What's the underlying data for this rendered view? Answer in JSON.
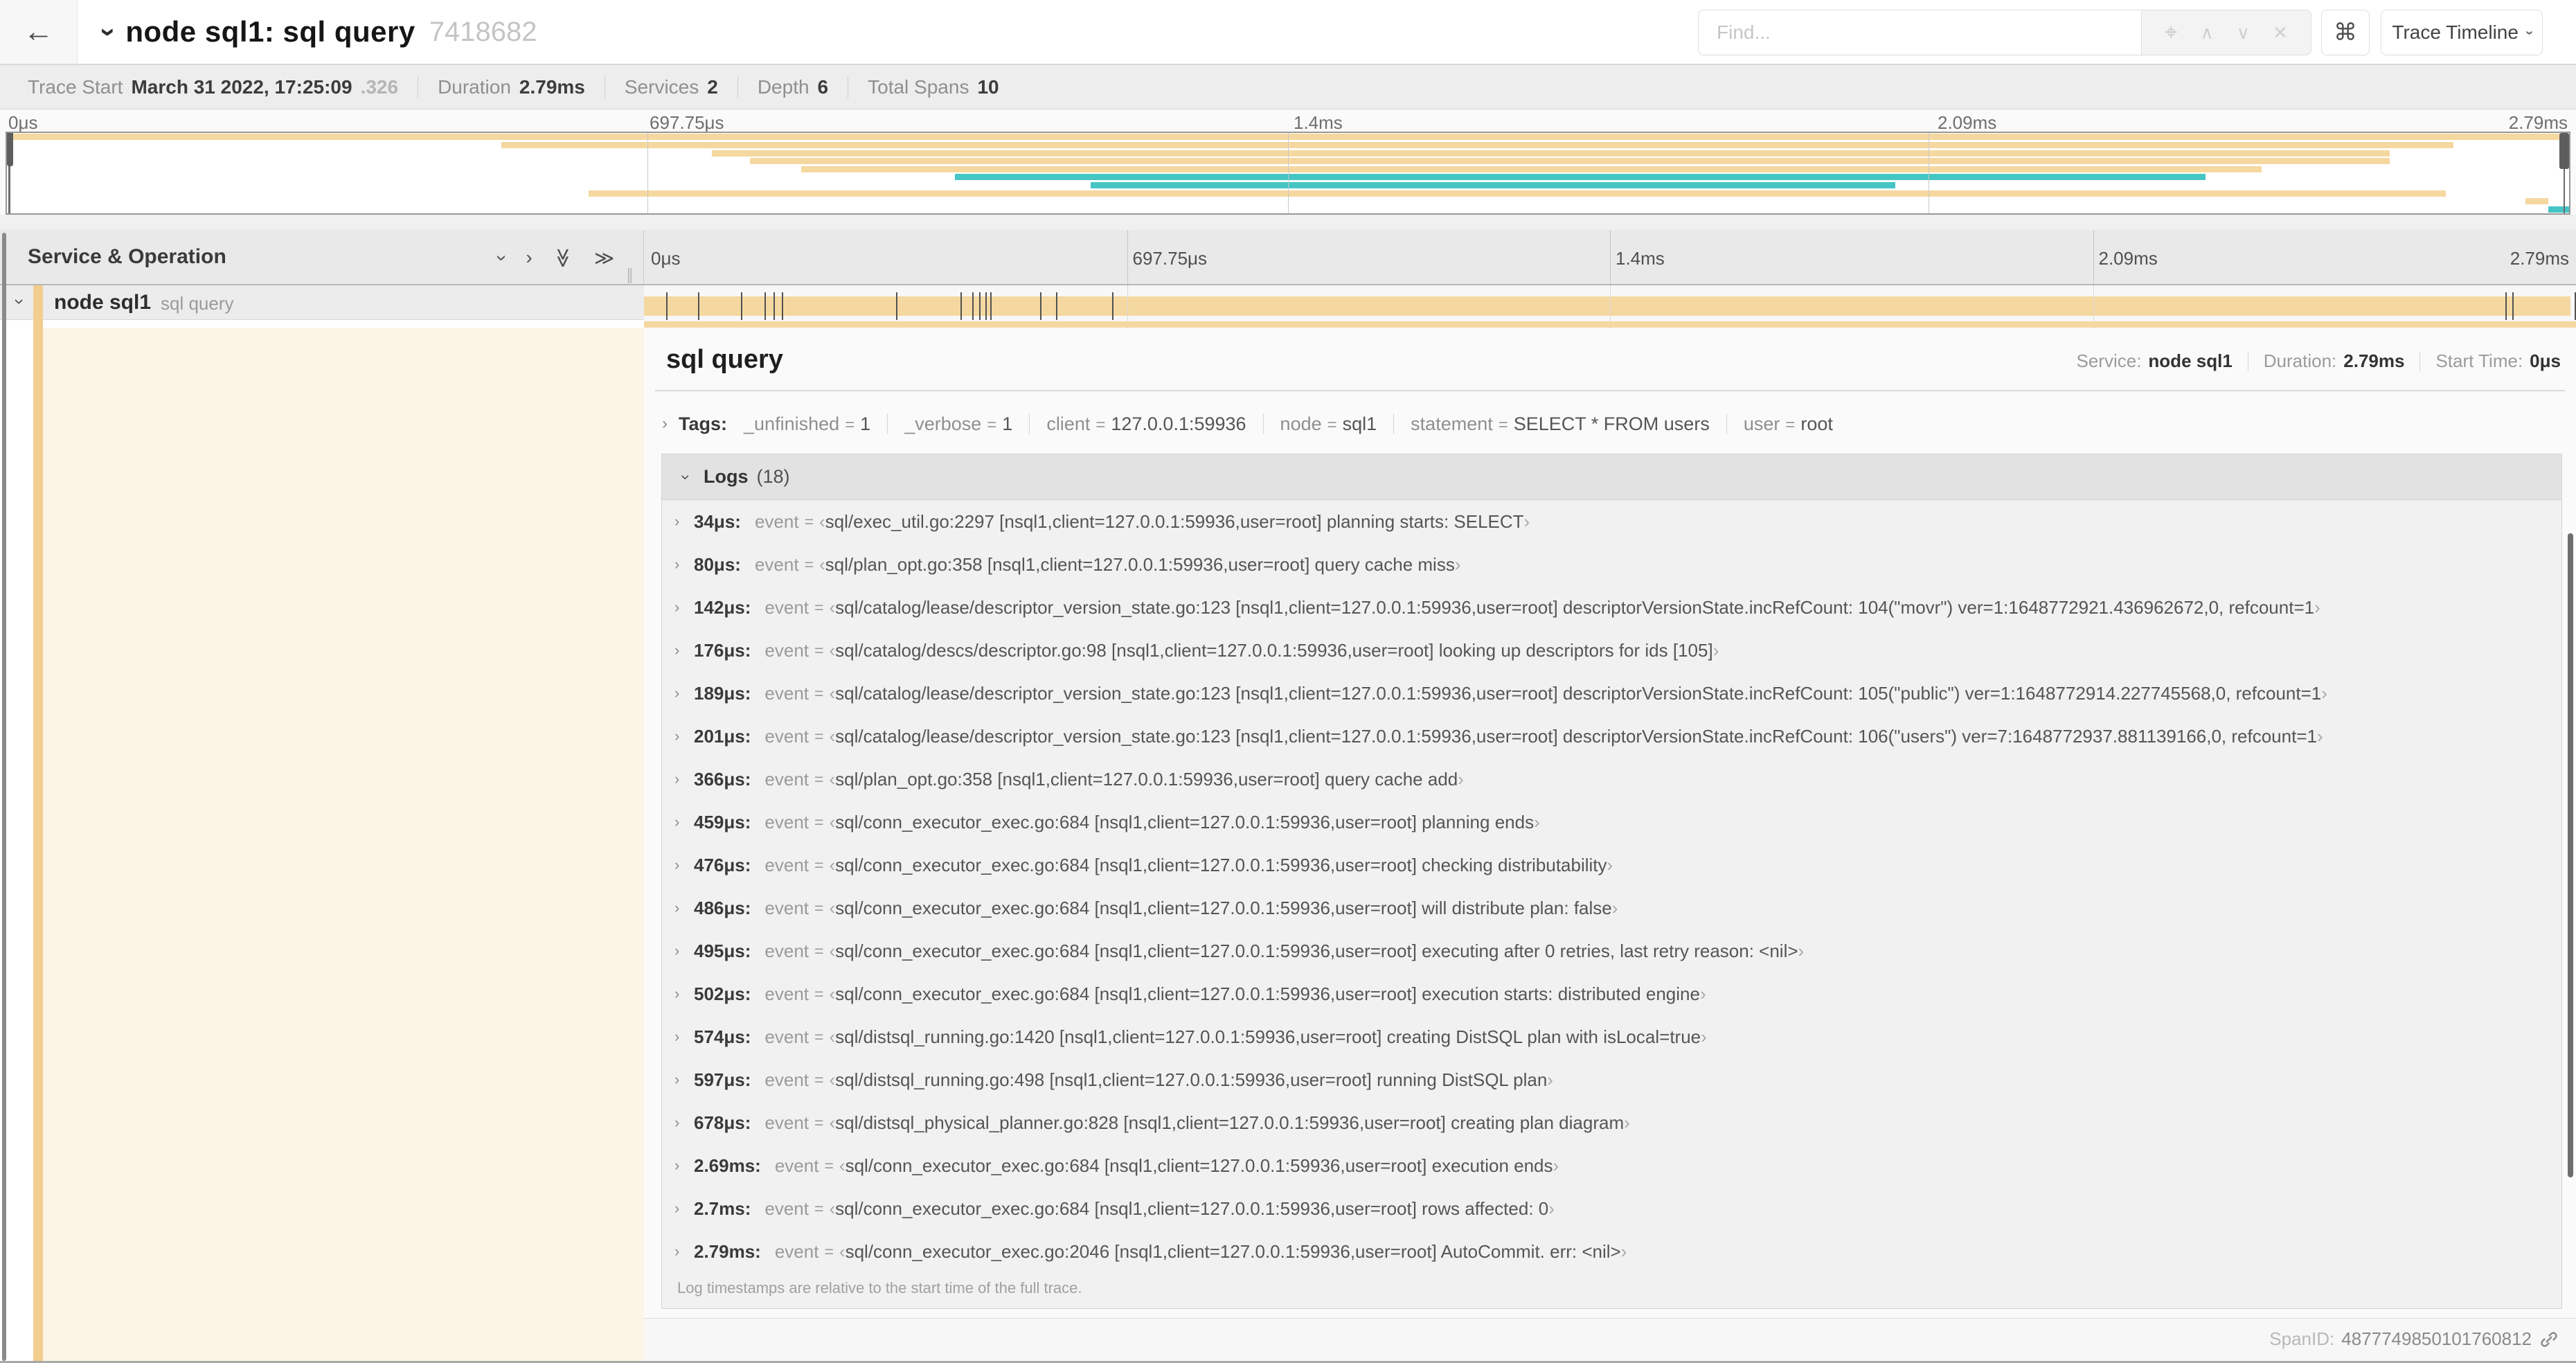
{
  "colors": {
    "span_tan": "#F5D8A0",
    "accent_tan": "#F1CE8E",
    "cream_bg": "#FCF5E5",
    "teal": "#45C5C4"
  },
  "icons": {
    "back": "←",
    "chevron": "›",
    "double_chevron": "≫",
    "command": "⌘",
    "target": "⌖",
    "up": "∧",
    "down": "∨",
    "close": "✕",
    "grip": "∥",
    "quote_open": "‹",
    "quote_close": "›"
  },
  "header": {
    "title": "node sql1: sql query",
    "trace_id": "7418682",
    "find_placeholder": "Find...",
    "shortcut_label": "⌘",
    "view_button": "Trace Timeline"
  },
  "meta": {
    "items": [
      {
        "label": "Trace Start",
        "value": "March 31 2022, 17:25:09",
        "suffix": ".326"
      },
      {
        "label": "Duration",
        "value": "2.79ms",
        "suffix": ""
      },
      {
        "label": "Services",
        "value": "2",
        "suffix": ""
      },
      {
        "label": "Depth",
        "value": "6",
        "suffix": ""
      },
      {
        "label": "Total Spans",
        "value": "10",
        "suffix": ""
      }
    ]
  },
  "timeline": {
    "ticks": [
      {
        "label": "0μs",
        "pct": 0
      },
      {
        "label": "697.75μs",
        "pct": 25
      },
      {
        "label": "1.4ms",
        "pct": 50
      },
      {
        "label": "2.09ms",
        "pct": 75
      },
      {
        "label": "2.79ms",
        "pct": 100
      }
    ],
    "grid_pcts": [
      25,
      50,
      75
    ],
    "left_header": "Service & Operation"
  },
  "minimap": {
    "rows": [
      {
        "color": "tan",
        "start": 0,
        "end": 100
      },
      {
        "color": "tan",
        "start": 19.3,
        "end": 95.5
      },
      {
        "color": "tan",
        "start": 27.5,
        "end": 93
      },
      {
        "color": "tan",
        "start": 29,
        "end": 93
      },
      {
        "color": "tan",
        "start": 31,
        "end": 88
      },
      {
        "color": "teal",
        "start": 37,
        "end": 85.8
      },
      {
        "color": "teal",
        "start": 42.3,
        "end": 73.7
      },
      {
        "color": "tan",
        "start": 22.7,
        "end": 95.2
      },
      {
        "color": "tan",
        "start": 98.3,
        "end": 99.2
      },
      {
        "color": "teal",
        "start": 99.2,
        "end": 100
      }
    ]
  },
  "span_row": {
    "service": "node sql1",
    "operation": "sql query",
    "log_marks_us": [
      34,
      80,
      142,
      176,
      189,
      201,
      366,
      459,
      476,
      486,
      495,
      502,
      574,
      597,
      678,
      2690,
      2700,
      2790
    ]
  },
  "trace": {
    "duration_us": 2790
  },
  "detail": {
    "title": "sql query",
    "stats": [
      {
        "label": "Service:",
        "value": "node sql1"
      },
      {
        "label": "Duration:",
        "value": "2.79ms"
      },
      {
        "label": "Start Time:",
        "value": "0μs"
      }
    ],
    "tags_label": "Tags:",
    "tags": [
      {
        "key": "_unfinished",
        "value": "1"
      },
      {
        "key": "_verbose",
        "value": "1"
      },
      {
        "key": "client",
        "value": "127.0.0.1:59936"
      },
      {
        "key": "node",
        "value": "sql1"
      },
      {
        "key": "statement",
        "value": "SELECT * FROM users"
      },
      {
        "key": "user",
        "value": "root"
      }
    ],
    "logs_label": "Logs",
    "logs_count": "(18)",
    "log_field": "event",
    "logs": [
      {
        "t": "34μs:",
        "v": "sql/exec_util.go:2297 [nsql1,client=127.0.0.1:59936,user=root] planning starts: SELECT"
      },
      {
        "t": "80μs:",
        "v": "sql/plan_opt.go:358 [nsql1,client=127.0.0.1:59936,user=root] query cache miss"
      },
      {
        "t": "142μs:",
        "v": "sql/catalog/lease/descriptor_version_state.go:123 [nsql1,client=127.0.0.1:59936,user=root] descriptorVersionState.incRefCount: 104(\"movr\") ver=1:1648772921.436962672,0, refcount=1"
      },
      {
        "t": "176μs:",
        "v": "sql/catalog/descs/descriptor.go:98 [nsql1,client=127.0.0.1:59936,user=root] looking up descriptors for ids [105]"
      },
      {
        "t": "189μs:",
        "v": "sql/catalog/lease/descriptor_version_state.go:123 [nsql1,client=127.0.0.1:59936,user=root] descriptorVersionState.incRefCount: 105(\"public\") ver=1:1648772914.227745568,0, refcount=1"
      },
      {
        "t": "201μs:",
        "v": "sql/catalog/lease/descriptor_version_state.go:123 [nsql1,client=127.0.0.1:59936,user=root] descriptorVersionState.incRefCount: 106(\"users\") ver=7:1648772937.881139166,0, refcount=1"
      },
      {
        "t": "366μs:",
        "v": "sql/plan_opt.go:358 [nsql1,client=127.0.0.1:59936,user=root] query cache add"
      },
      {
        "t": "459μs:",
        "v": "sql/conn_executor_exec.go:684 [nsql1,client=127.0.0.1:59936,user=root] planning ends"
      },
      {
        "t": "476μs:",
        "v": "sql/conn_executor_exec.go:684 [nsql1,client=127.0.0.1:59936,user=root] checking distributability"
      },
      {
        "t": "486μs:",
        "v": "sql/conn_executor_exec.go:684 [nsql1,client=127.0.0.1:59936,user=root] will distribute plan: false"
      },
      {
        "t": "495μs:",
        "v": "sql/conn_executor_exec.go:684 [nsql1,client=127.0.0.1:59936,user=root] executing after 0 retries, last retry reason: <nil>"
      },
      {
        "t": "502μs:",
        "v": "sql/conn_executor_exec.go:684 [nsql1,client=127.0.0.1:59936,user=root] execution starts: distributed engine"
      },
      {
        "t": "574μs:",
        "v": "sql/distsql_running.go:1420 [nsql1,client=127.0.0.1:59936,user=root] creating DistSQL plan with isLocal=true"
      },
      {
        "t": "597μs:",
        "v": "sql/distsql_running.go:498 [nsql1,client=127.0.0.1:59936,user=root] running DistSQL plan"
      },
      {
        "t": "678μs:",
        "v": "sql/distsql_physical_planner.go:828 [nsql1,client=127.0.0.1:59936,user=root] creating plan diagram"
      },
      {
        "t": "2.69ms:",
        "v": "sql/conn_executor_exec.go:684 [nsql1,client=127.0.0.1:59936,user=root] execution ends"
      },
      {
        "t": "2.7ms:",
        "v": "sql/conn_executor_exec.go:684 [nsql1,client=127.0.0.1:59936,user=root] rows affected: 0"
      },
      {
        "t": "2.79ms:",
        "v": "sql/conn_executor_exec.go:2046 [nsql1,client=127.0.0.1:59936,user=root] AutoCommit. err: <nil>"
      }
    ],
    "footnote": "Log timestamps are relative to the start time of the full trace."
  },
  "footer": {
    "spanid_label": "SpanID:",
    "spanid_value": "4877749850101760812"
  }
}
